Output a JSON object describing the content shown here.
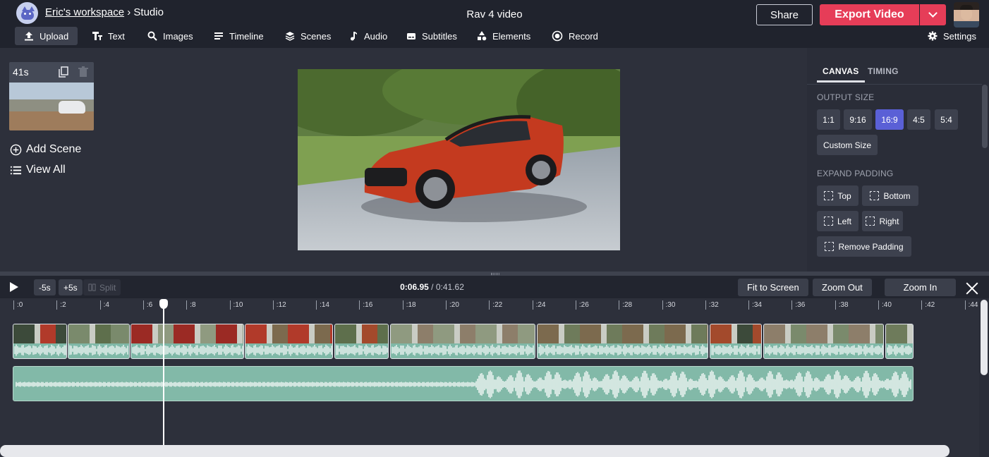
{
  "header": {
    "workspace": "Eric's workspace",
    "separator": "›",
    "section": "Studio",
    "project_title": "Rav 4 video",
    "share_label": "Share",
    "export_label": "Export Video"
  },
  "toolbar": {
    "items": [
      {
        "label": "Upload",
        "icon": "upload-icon",
        "active": true
      },
      {
        "label": "Text",
        "icon": "text-icon"
      },
      {
        "label": "Images",
        "icon": "search-icon"
      },
      {
        "label": "Timeline",
        "icon": "timeline-icon"
      },
      {
        "label": "Scenes",
        "icon": "layers-icon"
      },
      {
        "label": "Audio",
        "icon": "music-note-icon"
      },
      {
        "label": "Subtitles",
        "icon": "subtitles-icon"
      },
      {
        "label": "Elements",
        "icon": "shapes-icon"
      },
      {
        "label": "Record",
        "icon": "record-icon"
      }
    ],
    "settings_label": "Settings"
  },
  "scenes": {
    "scene_duration": "41s",
    "add_scene_label": "Add Scene",
    "view_all_label": "View All"
  },
  "panel": {
    "tabs": [
      "CANVAS",
      "TIMING"
    ],
    "active_tab": "CANVAS",
    "output_size_label": "OUTPUT SIZE",
    "ratios": [
      "1:1",
      "9:16",
      "16:9",
      "4:5",
      "5:4"
    ],
    "selected_ratio": "16:9",
    "custom_size_label": "Custom Size",
    "expand_padding_label": "EXPAND PADDING",
    "padding": {
      "top": "Top",
      "bottom": "Bottom",
      "left": "Left",
      "right": "Right",
      "remove": "Remove Padding"
    }
  },
  "timeline": {
    "back_label": "-5s",
    "fwd_label": "+5s",
    "split_label": "Split",
    "current_time": "0:06.95",
    "time_sep": " / ",
    "total_time": "0:41.62",
    "fit_label": "Fit to Screen",
    "zoom_out_label": "Zoom Out",
    "zoom_in_label": "Zoom In",
    "ruler": [
      ":0",
      ":2",
      ":4",
      ":6",
      ":8",
      ":10",
      ":12",
      ":14",
      ":16",
      ":18",
      ":20",
      ":22",
      ":24",
      ":26",
      ":28",
      ":30",
      ":32",
      ":34",
      ":36",
      ":38",
      ":40",
      ":42",
      ":44"
    ],
    "playhead_seconds": 6.95,
    "duration_seconds": 41.62
  },
  "colors": {
    "accent": "#5a60d6",
    "export": "#e63d58",
    "audio": "#82b9a8"
  }
}
